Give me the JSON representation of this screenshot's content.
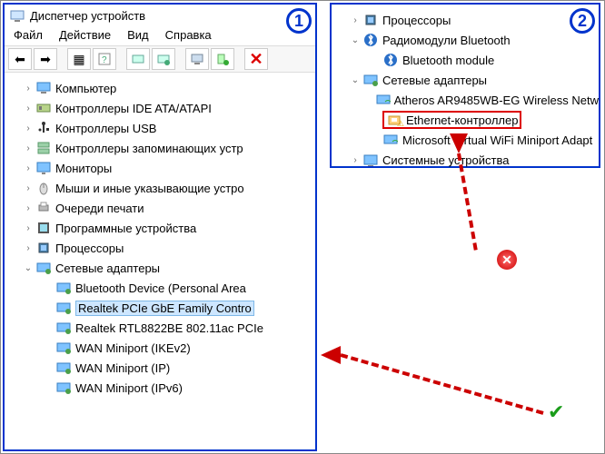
{
  "panel1": {
    "badge": "1",
    "title": "Диспетчер устройств",
    "menu": {
      "file": "Файл",
      "action": "Действие",
      "view": "Вид",
      "help": "Справка"
    },
    "tree": {
      "items": [
        {
          "label": "Компьютер",
          "icon": "monitor",
          "caret": "right"
        },
        {
          "label": "Контроллеры IDE ATA/ATAPI",
          "icon": "ide",
          "caret": "right"
        },
        {
          "label": "Контроллеры USB",
          "icon": "usb",
          "caret": "right"
        },
        {
          "label": "Контроллеры запоминающих устр",
          "icon": "storage",
          "caret": "right"
        },
        {
          "label": "Мониторы",
          "icon": "display",
          "caret": "right"
        },
        {
          "label": "Мыши и иные указывающие устро",
          "icon": "mouse",
          "caret": "right"
        },
        {
          "label": "Очереди печати",
          "icon": "printer",
          "caret": "right"
        },
        {
          "label": "Программные устройства",
          "icon": "software",
          "caret": "right"
        },
        {
          "label": "Процессоры",
          "icon": "cpu",
          "caret": "right"
        },
        {
          "label": "Сетевые адаптеры",
          "icon": "network",
          "caret": "down"
        }
      ],
      "network_children": [
        {
          "label": "Bluetooth Device (Personal Area"
        },
        {
          "label": "Realtek PCIe GbE Family Contro",
          "selected": true
        },
        {
          "label": "Realtek RTL8822BE 802.11ac PCIe"
        },
        {
          "label": "WAN Miniport (IKEv2)"
        },
        {
          "label": "WAN Miniport (IP)"
        },
        {
          "label": "WAN Miniport (IPv6)"
        }
      ]
    }
  },
  "panel2": {
    "badge": "2",
    "tree": {
      "items": [
        {
          "label": "Процессоры",
          "icon": "cpu",
          "caret": "right"
        },
        {
          "label": "Радиомодули Bluetooth",
          "icon": "bluetooth",
          "caret": "down"
        }
      ],
      "bt_children": [
        {
          "label": "Bluetooth module"
        }
      ],
      "net_label": "Сетевые адаптеры",
      "net_children": [
        {
          "label": "Atheros AR9485WB-EG Wireless Netw"
        },
        {
          "label": "Ethernet-контроллер",
          "warn": true,
          "boxed": true
        },
        {
          "label": "Microsoft Virtual WiFi Miniport Adapt"
        }
      ],
      "sys_label": "Системные устройства"
    }
  }
}
